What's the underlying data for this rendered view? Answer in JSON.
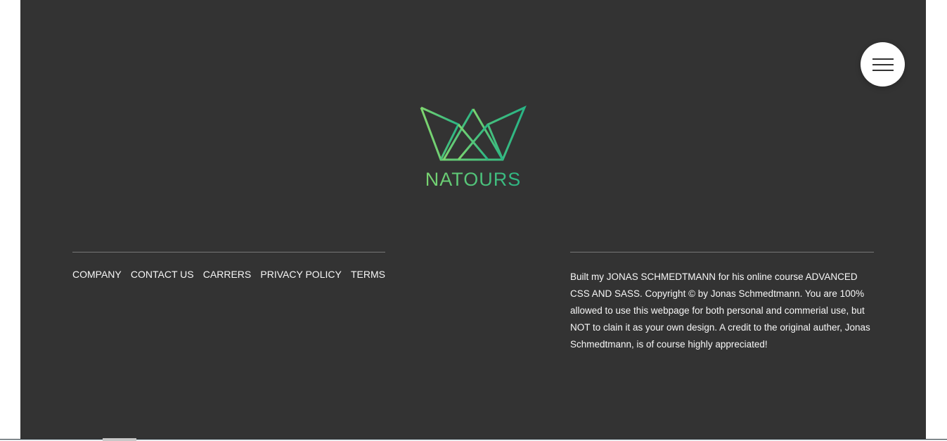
{
  "brand": {
    "name": "NATOURS",
    "gradient_start": "#7ed56f",
    "gradient_end": "#28b485"
  },
  "menu": {
    "icon": "hamburger-menu-icon"
  },
  "footer": {
    "background": "#333333",
    "nav_links": [
      {
        "label": "COMPANY"
      },
      {
        "label": "CONTACT US"
      },
      {
        "label": "CARRERS"
      },
      {
        "label": "PRIVACY POLICY"
      },
      {
        "label": "TERMS"
      }
    ],
    "copyright": "Built my JONAS SCHMEDTMANN for his online course ADVANCED CSS AND SASS. Copyright © by Jonas Schmedtmann. You are 100% allowed to use this webpage for both personal and commerial use, but NOT to clain it as your own design. A credit to the original auther, Jonas Schmedtmann, is of course highly appreciated!"
  }
}
